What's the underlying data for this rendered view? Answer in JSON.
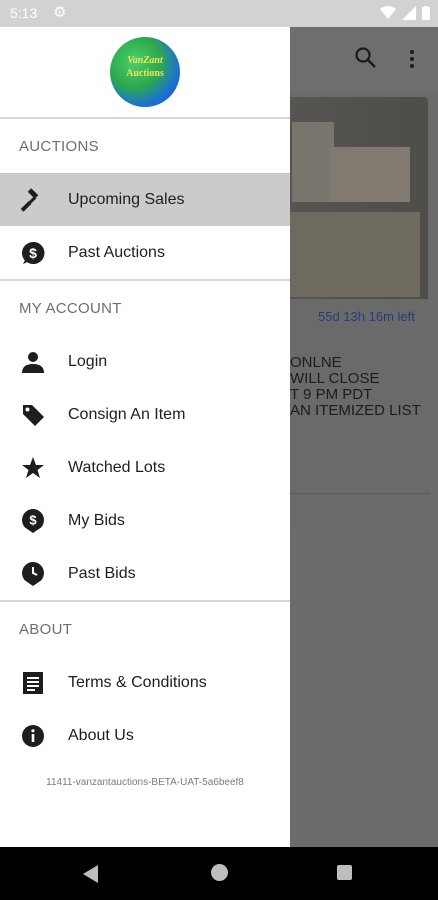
{
  "status_bar": {
    "time": "5:13"
  },
  "background": {
    "timer": "55d 13h 16m left",
    "description_lines": [
      "ONLNE",
      "WILL CLOSE",
      "T 9 PM PDT",
      "AN ITEMIZED LIST"
    ]
  },
  "drawer": {
    "logo": {
      "line1": "VanZant",
      "line2": "Auctions"
    },
    "sections": {
      "auctions": {
        "title": "AUCTIONS",
        "items": [
          {
            "label": "Upcoming Sales",
            "icon": "gavel-icon",
            "active": true
          },
          {
            "label": "Past Auctions",
            "icon": "dollar-circle-icon"
          }
        ]
      },
      "account": {
        "title": "MY ACCOUNT",
        "items": [
          {
            "label": "Login",
            "icon": "person-icon"
          },
          {
            "label": "Consign An Item",
            "icon": "tag-icon"
          },
          {
            "label": "Watched Lots",
            "icon": "star-icon"
          },
          {
            "label": "My Bids",
            "icon": "dollar-pin-icon"
          },
          {
            "label": "Past Bids",
            "icon": "clock-pin-icon"
          }
        ]
      },
      "about": {
        "title": "ABOUT",
        "items": [
          {
            "label": "Terms & Conditions",
            "icon": "document-icon"
          },
          {
            "label": "About Us",
            "icon": "info-icon"
          }
        ]
      }
    },
    "version": "11411-vanzantauctions-BETA-UAT-5a6beef8"
  },
  "colors": {
    "active_bg": "#cbcbcb",
    "timer": "#2c3a78",
    "drawer_bg": "#ffffff",
    "scrim": "#5f5f5f"
  }
}
